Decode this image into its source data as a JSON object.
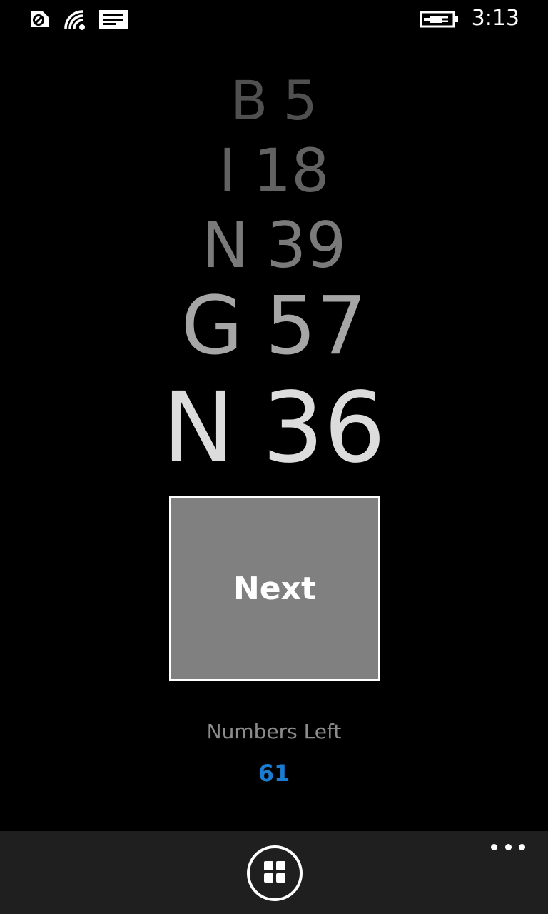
{
  "status_bar": {
    "time": "3:13",
    "icons": [
      "data-sense-icon",
      "wifi-icon",
      "message-icon",
      "battery-charging-icon"
    ]
  },
  "called_numbers": [
    {
      "letter": "B",
      "number": "5"
    },
    {
      "letter": "I",
      "number": "18"
    },
    {
      "letter": "N",
      "number": "39"
    },
    {
      "letter": "G",
      "number": "57"
    },
    {
      "letter": "N",
      "number": "36"
    }
  ],
  "next_button": {
    "label": "Next"
  },
  "numbers_left": {
    "label": "Numbers Left",
    "value": "61"
  },
  "app_bar": {
    "button_icon": "grid-icon",
    "more_icon": "ellipsis-icon"
  },
  "colors": {
    "background": "#000000",
    "accent": "#1b7bd1",
    "button": "#808080",
    "app_bar": "#1f1f1f"
  }
}
